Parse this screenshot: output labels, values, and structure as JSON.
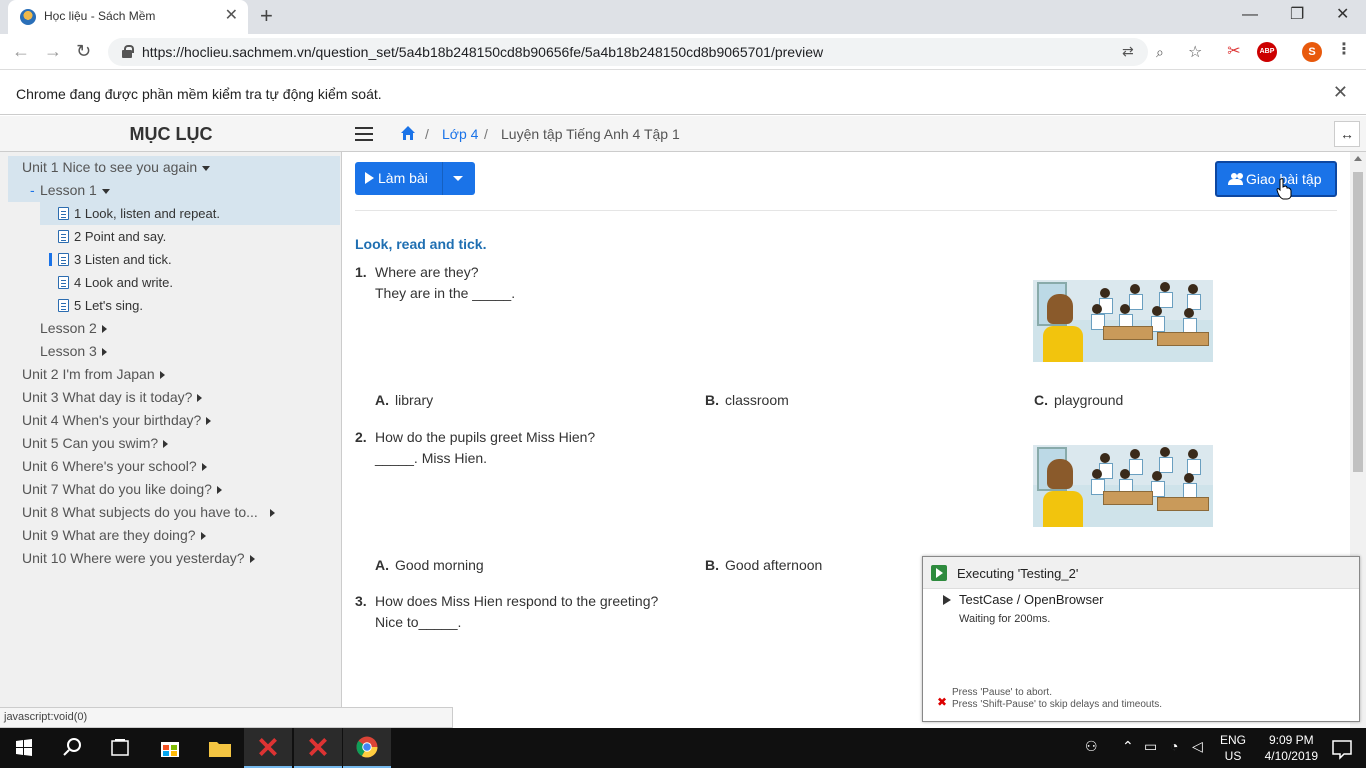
{
  "browser": {
    "tab_title": "Học liệu - Sách Mềm",
    "url": "https://hoclieu.sachmem.vn/question_set/5a4b18b248150cd8b90656fe/5a4b18b248150cd8b9065701/preview",
    "infobar_text": "Chrome đang được phần mềm kiểm tra tự động kiểm soát.",
    "profile_initial": "S",
    "abp_label": "ABP"
  },
  "sidebar": {
    "title": "MỤC LỤC",
    "units_top": "Unit 1 Nice to see you again",
    "lesson1": "Lesson 1",
    "items": [
      "1 Look, listen and repeat.",
      "2 Point and say.",
      "3 Listen and tick.",
      "4 Look and write.",
      "5 Let's sing."
    ],
    "lesson2": "Lesson 2",
    "lesson3": "Lesson 3",
    "units": [
      "Unit 2 I'm from Japan",
      "Unit 3 What day is it today?",
      "Unit 4 When's your birthday?",
      "Unit 5 Can you swim?",
      "Unit 6 Where's your school?",
      "Unit 7 What do you like doing?",
      "Unit 8 What subjects do you have to...",
      "Unit 9 What are they doing?",
      "Unit 10 Where were you yesterday?"
    ]
  },
  "breadcrumb": {
    "level1": "Lớp 4",
    "level2": "Luyện tập Tiếng Anh 4 Tập 1",
    "sep": "/"
  },
  "actions": {
    "lam_bai": "Làm bài",
    "giao_bai_tap": "Giao bài tập"
  },
  "quiz": {
    "instruction": "Look, read and tick.",
    "questions": [
      {
        "num": "1.",
        "text": "Where are they?",
        "line2": "They are in the _____.",
        "options": [
          {
            "letter": "A.",
            "text": "library"
          },
          {
            "letter": "B.",
            "text": "classroom"
          },
          {
            "letter": "C.",
            "text": "playground"
          }
        ]
      },
      {
        "num": "2.",
        "text": "How do the pupils greet Miss Hien?",
        "line2": "_____. Miss Hien.",
        "options": [
          {
            "letter": "A.",
            "text": "Good morning"
          },
          {
            "letter": "B.",
            "text": "Good afternoon"
          }
        ]
      },
      {
        "num": "3.",
        "text": "How does Miss Hien respond to the greeting?",
        "line2": "Nice to_____."
      }
    ]
  },
  "executor": {
    "title": "Executing 'Testing_2'",
    "step": "TestCase / OpenBrowser",
    "status": "Waiting for 200ms.",
    "note1": "Press 'Pause' to abort.",
    "note2": "Press 'Shift-Pause' to skip delays and timeouts."
  },
  "statusbar": "javascript:void(0)",
  "taskbar": {
    "lang": "ENG",
    "region": "US",
    "time": "9:09 PM",
    "date": "4/10/2019"
  }
}
